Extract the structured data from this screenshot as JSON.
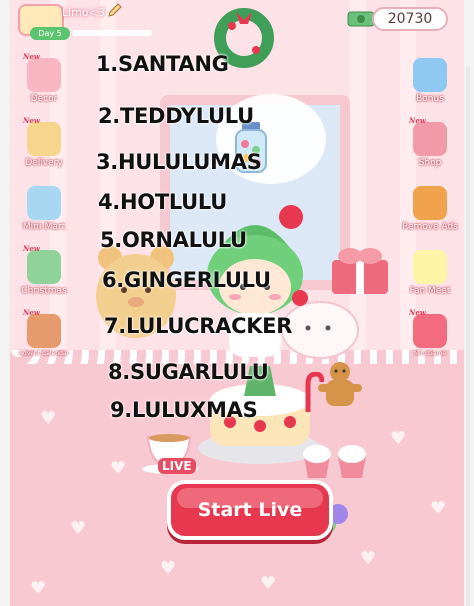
{
  "header": {
    "username": "Limo<3",
    "day_label": "Day 5",
    "coins": "20730"
  },
  "left_menu": [
    {
      "label": "Decor",
      "icon": "decor-icon",
      "new": "New"
    },
    {
      "label": "Delivery",
      "icon": "delivery-icon",
      "new": "New"
    },
    {
      "label": "Mini-Mart",
      "icon": "mini-mart-icon",
      "new": ""
    },
    {
      "label": "Christmas",
      "icon": "christmas-tree-icon",
      "new": "New"
    },
    {
      "label": "Advent Calendar",
      "icon": "advent-calendar-icon",
      "new": "New"
    }
  ],
  "right_menu": [
    {
      "label": "Bonus",
      "icon": "gift-box-icon",
      "new": ""
    },
    {
      "label": "Shop",
      "icon": "shop-icon",
      "new": "New"
    },
    {
      "label": "Remove Ads",
      "icon": "remove-ads-icon",
      "new": ""
    },
    {
      "label": "Fan Meet",
      "icon": "fan-meet-icon",
      "new": ""
    },
    {
      "label": "Mini Game",
      "icon": "mini-game-icon",
      "new": "New"
    }
  ],
  "names_list": [
    "1.SANTANG",
    "2.TEDDYLULU",
    "3.HULULUMAS",
    "4.HOTLULU",
    "5.ORNALULU",
    "6.GINGERLULU",
    "7.LULUCRACKER",
    "8.SUGARLULU",
    "9.LULUXMAS"
  ],
  "live_label": "LIVE",
  "start_button": "Start Live",
  "colors": {
    "start_button": "#e8384f",
    "floor": "#f8c9d1",
    "wall": "#fde2e7",
    "day_badge": "#5cc36e"
  }
}
